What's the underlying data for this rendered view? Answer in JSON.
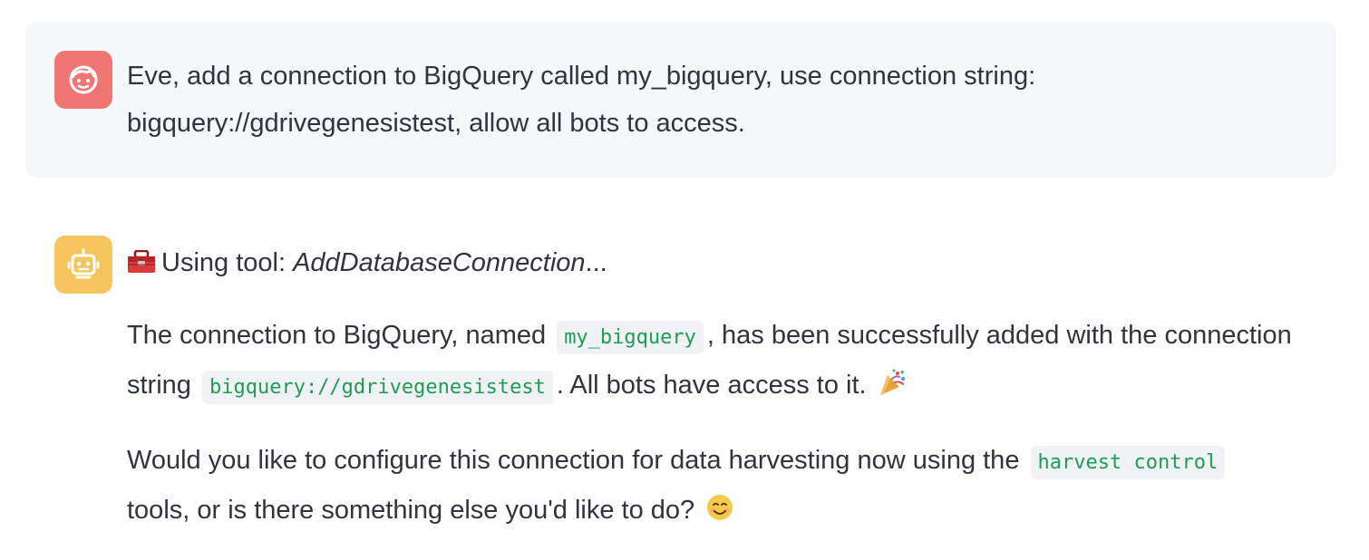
{
  "user_message": {
    "avatar_icon": "user-face-icon",
    "avatar_color": "#f07575",
    "lines": [
      "Eve, add a connection to BigQuery called my_bigquery, use connection string:",
      "bigquery://gdrivegenesistest, allow all bots to access."
    ]
  },
  "bot_message": {
    "avatar_icon": "robot-icon",
    "avatar_color": "#f6c55e",
    "tool": {
      "icon": "toolbox-icon",
      "prefix": "Using tool: ",
      "name": "AddDatabaseConnection",
      "suffix": "..."
    },
    "para1": {
      "line1_part1": "The connection to BigQuery, named",
      "code1": "my_bigquery",
      "line1_part2": ", has been successfully added with the connection",
      "line2_part1": "string",
      "code2": "bigquery://gdrivegenesistest",
      "line2_part2": ". All bots have access to it.",
      "emoji": "party-popper-icon"
    },
    "para2": {
      "line1_part1": "Would you like to configure this connection for data harvesting now using the",
      "code": "harvest control",
      "line2_part1": "tools, or is there something else you'd like to do?",
      "emoji": "smiling-face-icon"
    },
    "code_color": "#1f9d55"
  }
}
